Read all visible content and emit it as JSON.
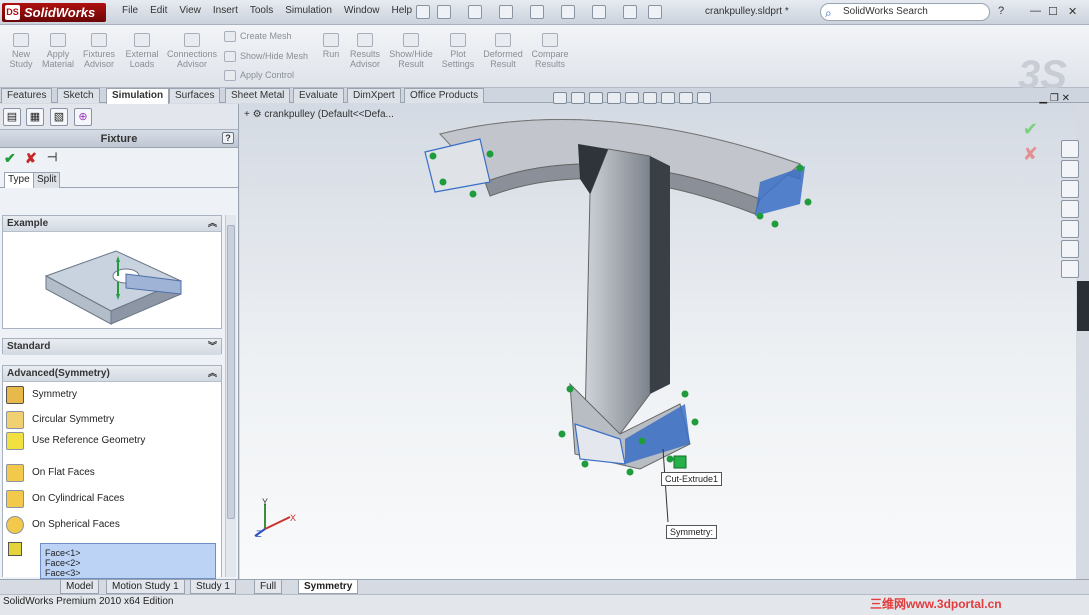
{
  "app": {
    "logo": "SolidWorks",
    "doc_title": "crankpulley.sldprt *",
    "search_placeholder": "SolidWorks Search"
  },
  "menu": [
    "File",
    "Edit",
    "View",
    "Insert",
    "Tools",
    "Simulation",
    "Window",
    "Help"
  ],
  "toolbar": {
    "new_study": "New\nStudy",
    "apply_material": "Apply\nMaterial",
    "fixtures_advisor": "Fixtures\nAdvisor",
    "external_loads": "External\nLoads",
    "connections_advisor": "Connections\nAdvisor",
    "create_mesh": "Create Mesh",
    "show_hide_mesh": "Show/Hide Mesh",
    "apply_control": "Apply Control",
    "run": "Run",
    "results_advisor": "Results\nAdvisor",
    "show_hide_result": "Show/Hide\nResult",
    "plot_settings": "Plot\nSettings",
    "deformed_result": "Deformed\nResult",
    "compare_results": "Compare\nResults"
  },
  "tabs": [
    "Features",
    "Sketch",
    "Simulation",
    "Surfaces",
    "Sheet Metal",
    "Evaluate",
    "DimXpert",
    "Office Products"
  ],
  "panel": {
    "title": "Fixture",
    "help": "?",
    "subtabs": [
      "Type",
      "Split"
    ],
    "example_header": "Example",
    "standard_header": "Standard",
    "advanced_header": "Advanced(Symmetry)",
    "options": [
      "Symmetry",
      "Circular Symmetry",
      "Use Reference Geometry",
      "On Flat Faces",
      "On Cylindrical Faces",
      "On Spherical Faces"
    ],
    "faces": [
      "Face<1>",
      "Face<2>",
      "Face<3>"
    ]
  },
  "viewport": {
    "tree_item": "crankpulley  (Default<<Defa...",
    "callout_cut": "Cut-Extrude1",
    "callout_sym": "Symmetry:"
  },
  "bottom_tabs": [
    "Model",
    "Motion Study 1",
    "Study 1",
    "Full",
    "Symmetry"
  ],
  "status": "SolidWorks Premium 2010 x64 Edition",
  "watermark": "三维网www.3dportal.cn",
  "colors": {
    "selection_blue": "#3a6fc4",
    "arrow_green": "#1f9c3c",
    "accent_red": "#b01010"
  }
}
